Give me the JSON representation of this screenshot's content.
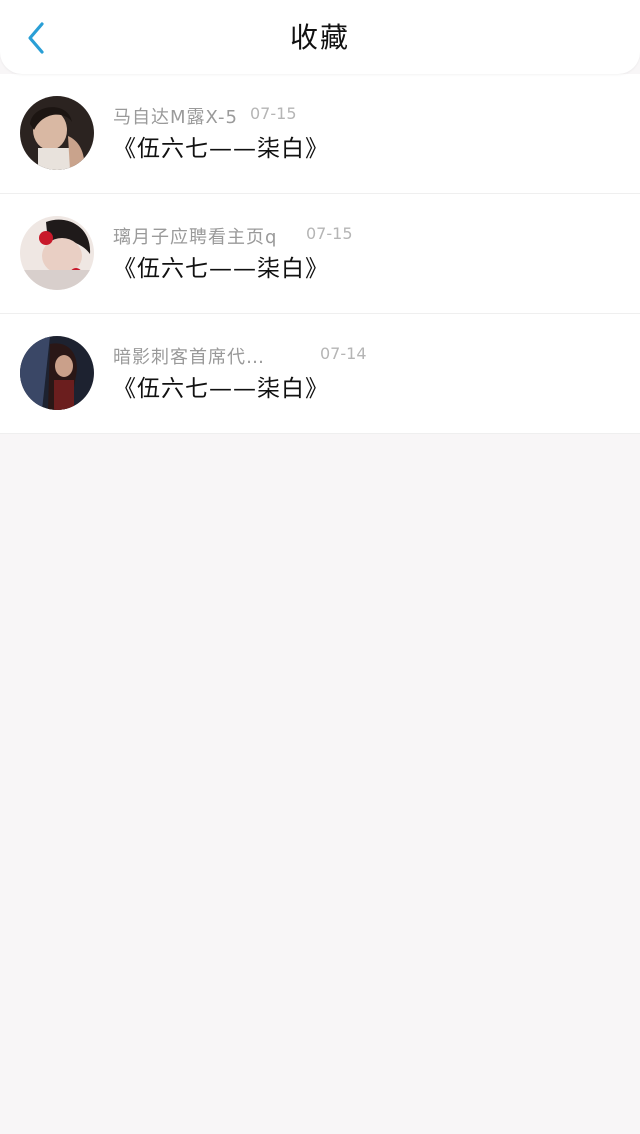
{
  "header": {
    "title": "收藏",
    "back_icon": "chevron-left-icon",
    "accent_color": "#2a9fd6"
  },
  "favorites": [
    {
      "user": "马自达M露X-5",
      "date": "07-15",
      "title": "《伍六七——柒白》"
    },
    {
      "user": "璃月子应聘看主页q",
      "date": "07-15",
      "title": "《伍六七——柒白》"
    },
    {
      "user": "暗影刺客首席代…",
      "date": "07-14",
      "title": "《伍六七——柒白》"
    }
  ]
}
